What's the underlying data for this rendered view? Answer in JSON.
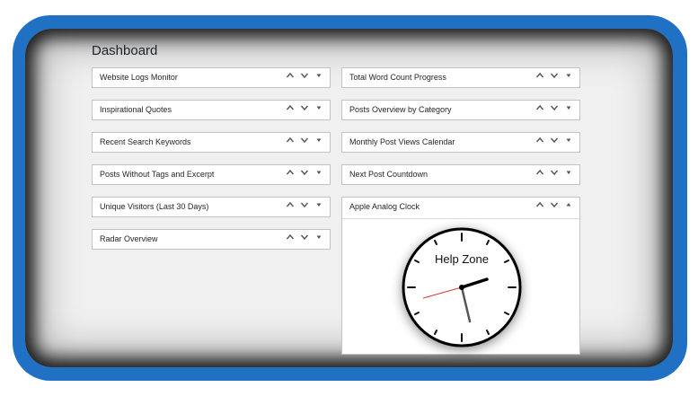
{
  "page_title": "Dashboard",
  "colors": {
    "frame": "#2070c4",
    "background": "#f0f0f1",
    "widget_border": "#c3c4c7",
    "second_hand": "#d63638"
  },
  "widgets_left": [
    "Website Logs Monitor",
    "Inspirational Quotes",
    "Recent Search Keywords",
    "Posts Without Tags and Excerpt",
    "Unique Visitors (Last 30 Days)",
    "Radar Overview"
  ],
  "widgets_right": [
    "Total Word Count Progress",
    "Posts Overview by Category",
    "Monthly Post Views Calendar",
    "Next Post Countdown"
  ],
  "clock_widget": {
    "title": "Apple Analog Clock",
    "label": "Help Zone"
  },
  "icons": {
    "move_up": "chevron-up-icon",
    "move_down": "chevron-down-icon",
    "toggle": "caret-icon"
  }
}
